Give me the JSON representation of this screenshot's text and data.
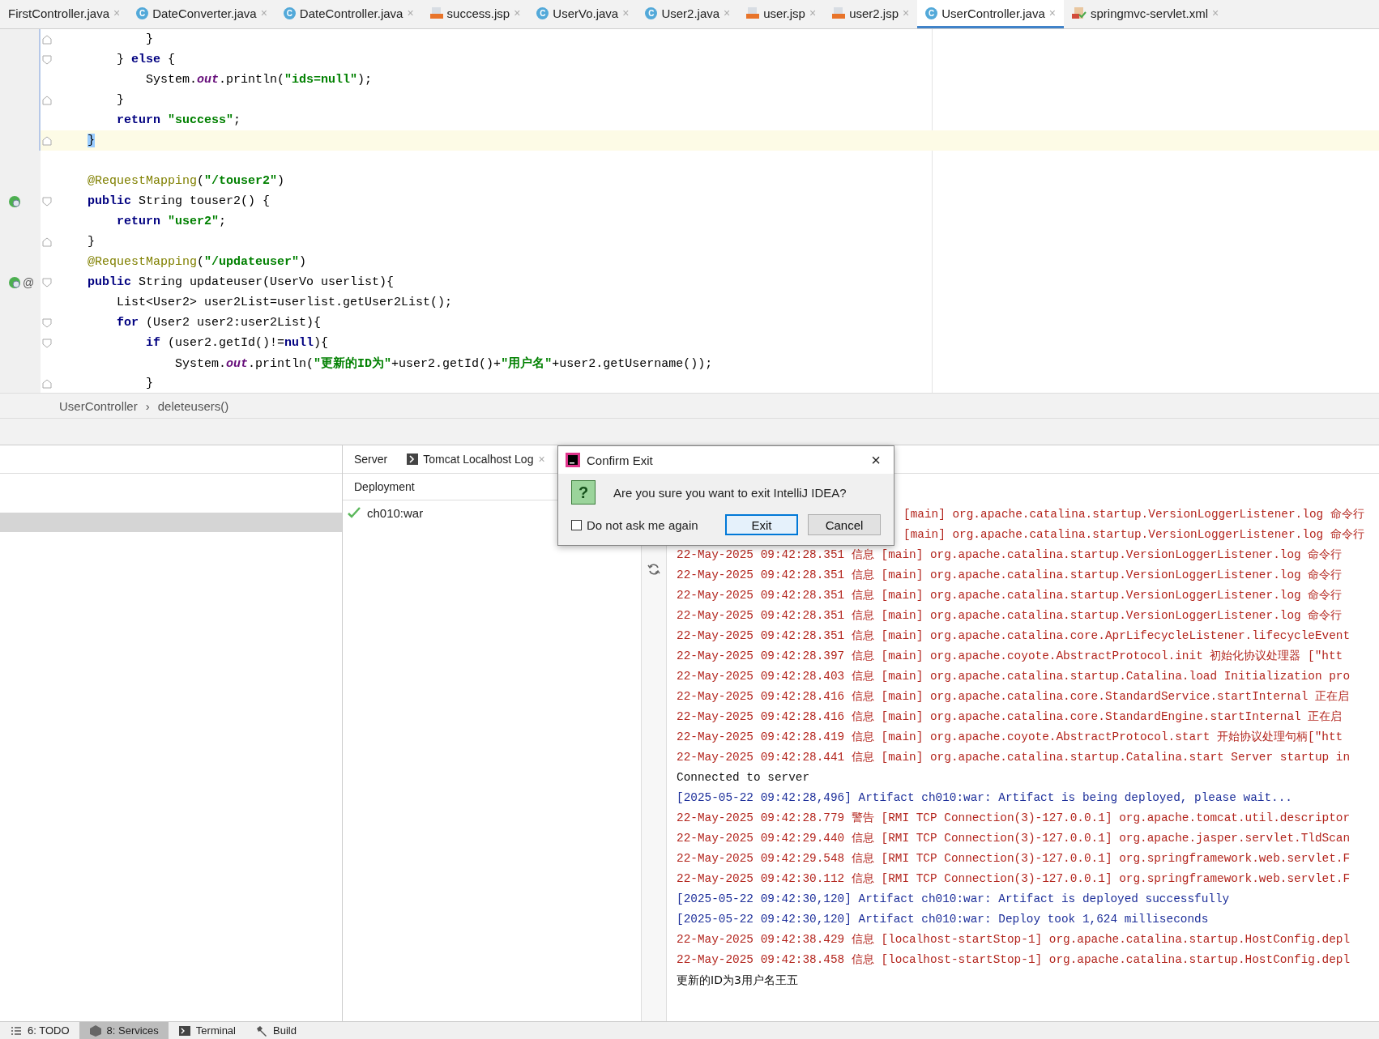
{
  "editor_tabs": [
    {
      "label": "FirstController.java",
      "kind": "none",
      "selected": false,
      "close": "×"
    },
    {
      "label": "DateConverter.java",
      "kind": "java",
      "icon_letter": "C",
      "selected": false,
      "close": "×"
    },
    {
      "label": "DateController.java",
      "kind": "java",
      "icon_letter": "C",
      "selected": false,
      "close": "×"
    },
    {
      "label": "success.jsp",
      "kind": "jsp",
      "selected": false,
      "close": "×"
    },
    {
      "label": "UserVo.java",
      "kind": "java",
      "icon_letter": "C",
      "selected": false,
      "close": "×"
    },
    {
      "label": "User2.java",
      "kind": "java",
      "icon_letter": "C",
      "selected": false,
      "close": "×"
    },
    {
      "label": "user.jsp",
      "kind": "jsp",
      "selected": false,
      "close": "×"
    },
    {
      "label": "user2.jsp",
      "kind": "jsp",
      "selected": false,
      "close": "×"
    },
    {
      "label": "UserController.java",
      "kind": "java",
      "icon_letter": "C",
      "selected": true,
      "close": "×"
    },
    {
      "label": "springmvc-servlet.xml",
      "kind": "xml",
      "selected": false,
      "close": "×"
    }
  ],
  "code_lines": [
    {
      "changed": true,
      "fold_end": true,
      "segments": [
        {
          "text": "            }",
          "kind": "plain"
        }
      ]
    },
    {
      "changed": true,
      "fold_start": true,
      "segments": [
        {
          "text": "        } ",
          "kind": "plain"
        },
        {
          "text": "else",
          "kind": "keyword"
        },
        {
          "text": " {",
          "kind": "plain"
        }
      ]
    },
    {
      "changed": true,
      "segments": [
        {
          "text": "            System.",
          "kind": "plain"
        },
        {
          "text": "out",
          "kind": "field"
        },
        {
          "text": ".println(",
          "kind": "plain"
        },
        {
          "text": "\"ids=null\"",
          "kind": "string"
        },
        {
          "text": ");",
          "kind": "plain"
        }
      ]
    },
    {
      "changed": true,
      "fold_end": true,
      "segments": [
        {
          "text": "        }",
          "kind": "plain"
        }
      ]
    },
    {
      "changed": true,
      "segments": [
        {
          "text": "        return",
          "kind": "keyword"
        },
        {
          "text": " \"success\"",
          "kind": "string"
        },
        {
          "text": ";",
          "kind": "plain"
        }
      ]
    },
    {
      "changed": true,
      "current": true,
      "fold_end": true,
      "segments": [
        {
          "text": "    }",
          "kind": "match"
        }
      ]
    },
    {
      "blank_line_before": true,
      "segments": [
        {
          "text": "    @RequestMapping",
          "kind": "annotation"
        },
        {
          "text": "(",
          "kind": "plain"
        },
        {
          "text": "\"/touser2\"",
          "kind": "string"
        },
        {
          "text": ")",
          "kind": "plain"
        }
      ]
    },
    {
      "web_icon": true,
      "fold_start": true,
      "segments": [
        {
          "text": "    public",
          "kind": "keyword"
        },
        {
          "text": " String touser2() {",
          "kind": "plain"
        }
      ]
    },
    {
      "segments": [
        {
          "text": "        return",
          "kind": "keyword"
        },
        {
          "text": " \"user2\"",
          "kind": "string"
        },
        {
          "text": ";",
          "kind": "plain"
        }
      ]
    },
    {
      "fold_end": true,
      "segments": [
        {
          "text": "    }",
          "kind": "plain"
        }
      ]
    },
    {
      "segments": [
        {
          "text": "    @RequestMapping",
          "kind": "annotation"
        },
        {
          "text": "(",
          "kind": "plain"
        },
        {
          "text": "\"/updateuser\"",
          "kind": "string"
        },
        {
          "text": ")",
          "kind": "plain"
        }
      ]
    },
    {
      "web_icon": true,
      "gutter_mark": "@",
      "fold_start": true,
      "segments": [
        {
          "text": "    public",
          "kind": "keyword"
        },
        {
          "text": " String updateuser(UserVo userlist){",
          "kind": "plain"
        }
      ]
    },
    {
      "segments": [
        {
          "text": "        List<User2> user2List=userlist.getUser2List();",
          "kind": "plain"
        }
      ]
    },
    {
      "fold_start": true,
      "segments": [
        {
          "text": "        for",
          "kind": "keyword"
        },
        {
          "text": " (User2 user2:user2List){",
          "kind": "plain"
        }
      ]
    },
    {
      "fold_start": true,
      "segments": [
        {
          "text": "            if",
          "kind": "keyword"
        },
        {
          "text": " (user2.getId()!=",
          "kind": "plain"
        },
        {
          "text": "null",
          "kind": "keyword"
        },
        {
          "text": "){",
          "kind": "plain"
        }
      ]
    },
    {
      "segments": [
        {
          "text": "                System.",
          "kind": "plain"
        },
        {
          "text": "out",
          "kind": "field"
        },
        {
          "text": ".println(",
          "kind": "plain"
        },
        {
          "text": "\"更新的ID为\"",
          "kind": "string"
        },
        {
          "text": "+user2.getId()+",
          "kind": "plain"
        },
        {
          "text": "\"用户名\"",
          "kind": "string"
        },
        {
          "text": "+user2.getUsername());",
          "kind": "plain"
        }
      ]
    },
    {
      "fold_end": true,
      "segments": [
        {
          "text": "            }",
          "kind": "plain"
        }
      ]
    }
  ],
  "breadcrumb": {
    "items": [
      "UserController",
      "deleteusers()"
    ],
    "separator": "›"
  },
  "services_tree": {
    "rows": [
      {
        "selected": false
      },
      {
        "selected": false
      },
      {
        "selected": true
      }
    ]
  },
  "panel_tabs": [
    {
      "label": "Server",
      "kind": "plain"
    },
    {
      "label": "Tomcat Localhost Log",
      "kind": "console",
      "close": "×"
    }
  ],
  "deployment": {
    "header": "Deployment",
    "items": [
      {
        "label": "ch010:war",
        "kind": "ok"
      }
    ]
  },
  "console_lines": [
    {
      "kind": "log",
      "covered": true,
      "text": "[main] org.apache.catalina.startup.VersionLoggerListener.log 命令行"
    },
    {
      "kind": "log",
      "covered": true,
      "text": "[main] org.apache.catalina.startup.VersionLoggerListener.log 命令行"
    },
    {
      "kind": "log",
      "text": "22-May-2025 09:42:28.351 信息 [main] org.apache.catalina.startup.VersionLoggerListener.log 命令行"
    },
    {
      "kind": "log",
      "text": "22-May-2025 09:42:28.351 信息 [main] org.apache.catalina.startup.VersionLoggerListener.log 命令行"
    },
    {
      "kind": "log",
      "text": "22-May-2025 09:42:28.351 信息 [main] org.apache.catalina.startup.VersionLoggerListener.log 命令行"
    },
    {
      "kind": "log",
      "text": "22-May-2025 09:42:28.351 信息 [main] org.apache.catalina.startup.VersionLoggerListener.log 命令行"
    },
    {
      "kind": "log",
      "text": "22-May-2025 09:42:28.351 信息 [main] org.apache.catalina.core.AprLifecycleListener.lifecycleEvent"
    },
    {
      "kind": "log",
      "text": "22-May-2025 09:42:28.397 信息 [main] org.apache.coyote.AbstractProtocol.init 初始化协议处理器 [\"htt"
    },
    {
      "kind": "log",
      "text": "22-May-2025 09:42:28.403 信息 [main] org.apache.catalina.startup.Catalina.load Initialization pro"
    },
    {
      "kind": "log",
      "text": "22-May-2025 09:42:28.416 信息 [main] org.apache.catalina.core.StandardService.startInternal 正在启"
    },
    {
      "kind": "log",
      "text": "22-May-2025 09:42:28.416 信息 [main] org.apache.catalina.core.StandardEngine.startInternal 正在启"
    },
    {
      "kind": "log",
      "text": "22-May-2025 09:42:28.419 信息 [main] org.apache.coyote.AbstractProtocol.start 开始协议处理句柄[\"htt"
    },
    {
      "kind": "log",
      "text": "22-May-2025 09:42:28.441 信息 [main] org.apache.catalina.startup.Catalina.start Server startup in"
    },
    {
      "kind": "plain",
      "text": "Connected to server"
    },
    {
      "kind": "artifact",
      "text": "[2025-05-22 09:42:28,496] Artifact ch010:war: Artifact is being deployed, please wait..."
    },
    {
      "kind": "log",
      "text": "22-May-2025 09:42:28.779 警告 [RMI TCP Connection(3)-127.0.0.1] org.apache.tomcat.util.descriptor"
    },
    {
      "kind": "log",
      "text": "22-May-2025 09:42:29.440 信息 [RMI TCP Connection(3)-127.0.0.1] org.apache.jasper.servlet.TldScan"
    },
    {
      "kind": "log",
      "text": "22-May-2025 09:42:29.548 信息 [RMI TCP Connection(3)-127.0.0.1] org.springframework.web.servlet.F"
    },
    {
      "kind": "log",
      "text": "22-May-2025 09:42:30.112 信息 [RMI TCP Connection(3)-127.0.0.1] org.springframework.web.servlet.F"
    },
    {
      "kind": "artifact",
      "text": "[2025-05-22 09:42:30,120] Artifact ch010:war: Artifact is deployed successfully"
    },
    {
      "kind": "artifact",
      "text": "[2025-05-22 09:42:30,120] Artifact ch010:war: Deploy took 1,624 milliseconds"
    },
    {
      "kind": "log",
      "text": "22-May-2025 09:42:38.429 信息 [localhost-startStop-1] org.apache.catalina.startup.HostConfig.depl"
    },
    {
      "kind": "log",
      "text": "22-May-2025 09:42:38.458 信息 [localhost-startStop-1] org.apache.catalina.startup.HostConfig.depl"
    },
    {
      "kind": "output",
      "text": "更新的ID为3用户名王五"
    }
  ],
  "dialog": {
    "title": "Confirm Exit",
    "close": "×",
    "icon_glyph": "?",
    "message": "Are you sure you want to exit IntelliJ IDEA?",
    "checkbox": {
      "label": "Do not ask me again",
      "checked": false
    },
    "buttons": [
      {
        "label": "Exit",
        "default": true
      },
      {
        "label": "Cancel",
        "default": false
      }
    ]
  },
  "tool_tabs": [
    {
      "label": "6: TODO",
      "kind": "list",
      "selected": false
    },
    {
      "label": "8: Services",
      "kind": "services",
      "selected": true
    },
    {
      "label": "Terminal",
      "kind": "terminal",
      "selected": false
    },
    {
      "label": "Build",
      "kind": "build",
      "selected": false
    }
  ]
}
